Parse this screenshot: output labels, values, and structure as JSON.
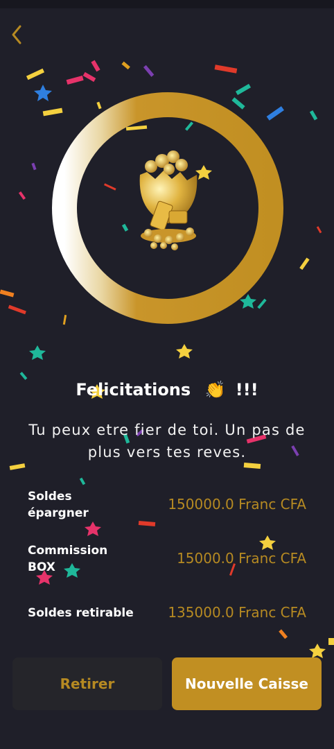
{
  "header": {
    "back_icon": "chevron-left-icon",
    "accent": "#b68a22"
  },
  "celebration": {
    "ring_color": "#c18f22",
    "image": "golden-egg-with-coins-and-bars"
  },
  "message": {
    "title": "Felicitations",
    "title_emoji": "👏",
    "title_suffix": "!!!",
    "subtitle": "Tu peux etre fier de toi. Un pas de plus vers tes reves."
  },
  "balances": [
    {
      "label": "Soldes épargner",
      "value": "150000.0 Franc CFA"
    },
    {
      "label": "Commission BOX",
      "value": "15000.0 Franc CFA"
    },
    {
      "label": "Soldes retirable",
      "value": "135000.0 Franc CFA"
    }
  ],
  "actions": {
    "withdraw_label": "Retirer",
    "new_box_label": "Nouvelle Caisse"
  },
  "colors": {
    "background": "#1f1f29",
    "gold": "#c18f22",
    "value_text": "#b68a22",
    "secondary_button": "#25252a"
  }
}
